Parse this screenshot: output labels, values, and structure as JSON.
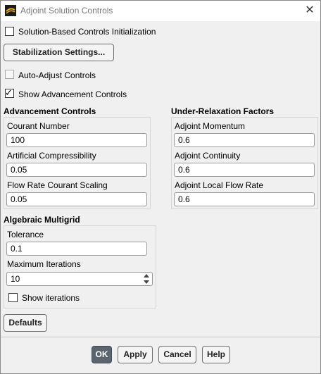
{
  "window": {
    "title": "Adjoint Solution Controls",
    "app_icon": "ansys-fluent-icon",
    "close_icon": "close-icon"
  },
  "options": {
    "solution_init": {
      "label": "Solution-Based Controls Initialization",
      "checked": false
    },
    "stabilization_button": "Stabilization Settings...",
    "auto_adjust": {
      "label": "Auto-Adjust Controls",
      "checked": false,
      "enabled": false
    },
    "show_advancement": {
      "label": "Show Advancement Controls",
      "checked": true
    }
  },
  "advancement": {
    "title": "Advancement Controls",
    "courant": {
      "label": "Courant Number",
      "value": "100"
    },
    "compressibility": {
      "label": "Artificial Compressibility",
      "value": "0.05"
    },
    "flow_rate_scaling": {
      "label": "Flow Rate Courant Scaling",
      "value": "0.05"
    }
  },
  "relaxation": {
    "title": "Under-Relaxation Factors",
    "momentum": {
      "label": "Adjoint Momentum",
      "value": "0.6"
    },
    "continuity": {
      "label": "Adjoint Continuity",
      "value": "0.6"
    },
    "local_flow_rate": {
      "label": "Adjoint Local Flow Rate",
      "value": "0.6"
    }
  },
  "multigrid": {
    "title": "Algebraic Multigrid",
    "tolerance": {
      "label": "Tolerance",
      "value": "0.1"
    },
    "max_iterations": {
      "label": "Maximum Iterations",
      "value": "10"
    },
    "show_iterations": {
      "label": "Show iterations",
      "checked": false
    }
  },
  "buttons": {
    "defaults": "Defaults",
    "ok": "OK",
    "apply": "Apply",
    "cancel": "Cancel",
    "help": "Help"
  },
  "colors": {
    "ok_button": "#5a6570",
    "window_bg": "#f0f0f0"
  }
}
